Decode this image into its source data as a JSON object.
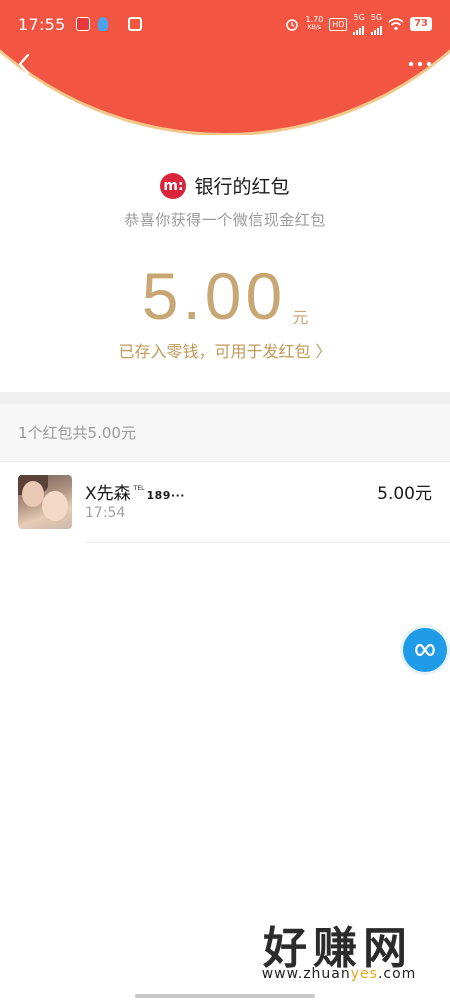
{
  "status_bar": {
    "time": "17:55",
    "net_speed_value": "1.70",
    "net_speed_unit": "KB/s",
    "hd_label": "HD",
    "sim1_label": "5G",
    "sim2_label": "5G",
    "battery": "73"
  },
  "sender": {
    "logo_text": "m:",
    "name": "银行的红包"
  },
  "greeting": "恭喜你获得一个微信现金红包",
  "amount": {
    "value": "5.00",
    "unit": "元"
  },
  "stored_link": "已存入零钱，可用于发红包 〉",
  "list": {
    "header": "1个红包共5.00元",
    "items": [
      {
        "name": "X先森",
        "tel_tag": "TEL",
        "tel_num": "189···",
        "time": "17:54",
        "amount": "5.00元"
      }
    ]
  },
  "watermark": {
    "main": "好赚网",
    "url_a": "www.zhuan",
    "url_b": "yes",
    "url_c": ".com"
  },
  "colors": {
    "header_red": "#f25643",
    "gold": "#c9a774",
    "float_blue": "#1f9be8"
  }
}
